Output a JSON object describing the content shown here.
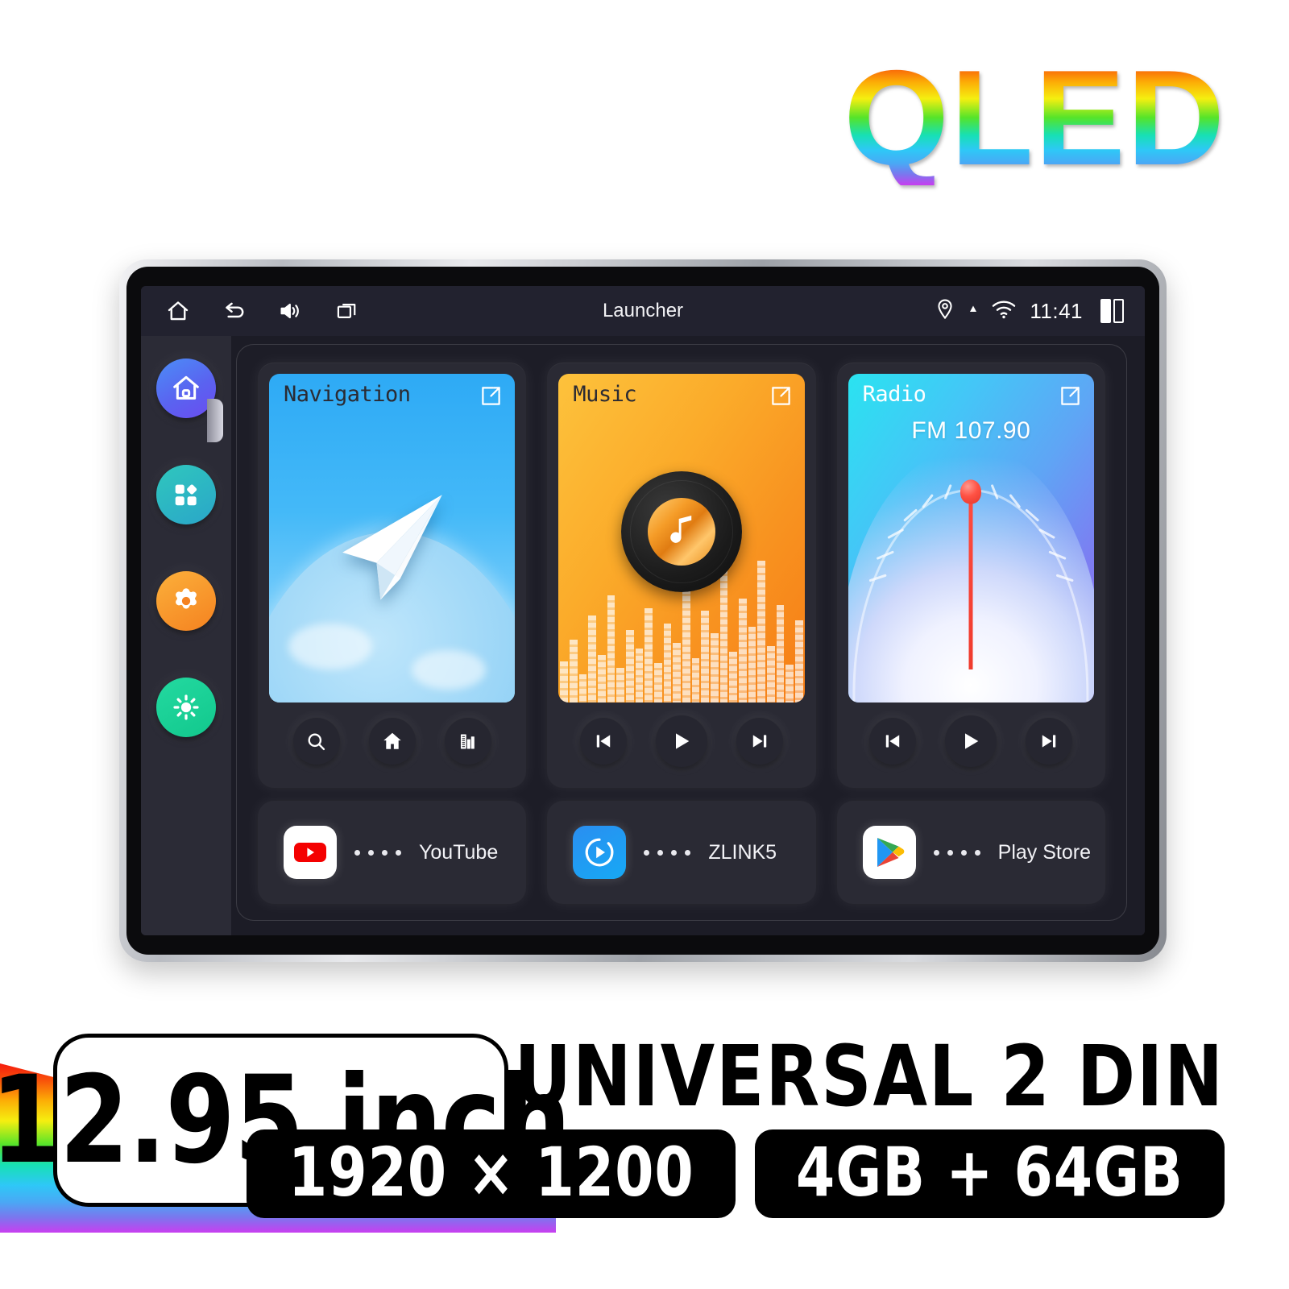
{
  "brand": {
    "logo_text": "QLED"
  },
  "device": {
    "status_bar": {
      "title": "Launcher",
      "time": "11:41",
      "icons": [
        "home-icon",
        "back-icon",
        "volume-icon",
        "recents-icon",
        "location-icon",
        "wifi-icon",
        "split-screen-icon"
      ]
    },
    "sidebar": {
      "items": [
        {
          "name": "home",
          "icon": "home-icon",
          "active": true,
          "color": "#5a63f0"
        },
        {
          "name": "apps",
          "icon": "apps-grid-icon",
          "active": false,
          "color": "#2aa6c9"
        },
        {
          "name": "settings",
          "icon": "gear-icon",
          "active": false,
          "color": "#f58220"
        },
        {
          "name": "brightness",
          "icon": "sun-icon",
          "active": false,
          "color": "#12c88d"
        }
      ]
    },
    "widgets": [
      {
        "title": "Navigation",
        "accent": "#2eaaf5",
        "controls": [
          "search-icon",
          "home-icon",
          "building-icon"
        ]
      },
      {
        "title": "Music",
        "accent": "#f89320",
        "controls": [
          "previous-icon",
          "play-icon",
          "next-icon"
        ]
      },
      {
        "title": "Radio",
        "frequency": "FM 107.90",
        "accent": "#5fa5f5",
        "controls": [
          "previous-icon",
          "play-icon",
          "next-icon"
        ]
      }
    ],
    "shortcuts": [
      {
        "label": "YouTube",
        "icon": "youtube-icon",
        "dots": 4
      },
      {
        "label": "ZLINK5",
        "icon": "zlink-icon",
        "dots": 4
      },
      {
        "label": "Play Store",
        "icon": "play-store-icon",
        "dots": 4
      }
    ]
  },
  "banner": {
    "screen_size": "12.95 inch",
    "headline": "UNIVERSAL 2 DIN",
    "badges": [
      {
        "text": "1920 × 1200"
      },
      {
        "text": "4GB + 64GB"
      }
    ]
  }
}
